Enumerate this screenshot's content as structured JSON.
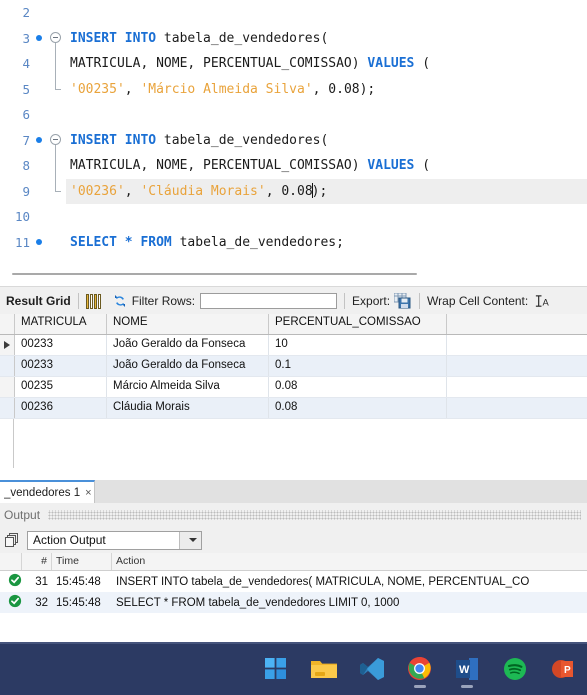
{
  "editor": {
    "lines": [
      {
        "num": "2",
        "bp": false,
        "fold": "none",
        "tokens": []
      },
      {
        "num": "3",
        "bp": true,
        "fold": "start",
        "tokens": [
          {
            "t": "kw",
            "v": "INSERT INTO "
          },
          {
            "t": "id",
            "v": "tabela_de_vendedores("
          }
        ]
      },
      {
        "num": "4",
        "bp": false,
        "fold": "mid",
        "tokens": [
          {
            "t": "id",
            "v": "MATRICULA, NOME, PERCENTUAL_COMISSAO) "
          },
          {
            "t": "kw",
            "v": "VALUES "
          },
          {
            "t": "id",
            "v": "("
          }
        ]
      },
      {
        "num": "5",
        "bp": false,
        "fold": "end",
        "tokens": [
          {
            "t": "str",
            "v": "'00235'"
          },
          {
            "t": "pun",
            "v": ", "
          },
          {
            "t": "str",
            "v": "'Márcio Almeida Silva'"
          },
          {
            "t": "pun",
            "v": ", "
          },
          {
            "t": "num",
            "v": "0.08"
          },
          {
            "t": "pun",
            "v": ");"
          }
        ]
      },
      {
        "num": "6",
        "bp": false,
        "fold": "none",
        "tokens": []
      },
      {
        "num": "7",
        "bp": true,
        "fold": "start",
        "tokens": [
          {
            "t": "kw",
            "v": "INSERT INTO "
          },
          {
            "t": "id",
            "v": "tabela_de_vendedores("
          }
        ]
      },
      {
        "num": "8",
        "bp": false,
        "fold": "mid",
        "tokens": [
          {
            "t": "id",
            "v": "MATRICULA, NOME, PERCENTUAL_COMISSAO) "
          },
          {
            "t": "kw",
            "v": "VALUES "
          },
          {
            "t": "id",
            "v": "("
          }
        ]
      },
      {
        "num": "9",
        "bp": false,
        "fold": "end",
        "highlight": true,
        "tokens": [
          {
            "t": "str",
            "v": "'00236'"
          },
          {
            "t": "pun",
            "v": ", "
          },
          {
            "t": "str",
            "v": "'Cláudia Morais'"
          },
          {
            "t": "pun",
            "v": ", "
          },
          {
            "t": "num",
            "v": "0.08"
          },
          {
            "t": "caret",
            "v": ""
          },
          {
            "t": "pun",
            "v": ");"
          }
        ]
      },
      {
        "num": "10",
        "bp": false,
        "fold": "none",
        "tokens": []
      },
      {
        "num": "11",
        "bp": true,
        "fold": "none",
        "tokens": [
          {
            "t": "kw",
            "v": "SELECT "
          },
          {
            "t": "kw",
            "v": "* "
          },
          {
            "t": "kw",
            "v": "FROM "
          },
          {
            "t": "id",
            "v": "tabela_de_vendedores;"
          }
        ]
      }
    ]
  },
  "result_toolbar": {
    "title": "Result Grid",
    "grid_icon": "grid-view-icon",
    "refresh_icon": "refresh-icon",
    "filter_label": "Filter Rows:",
    "filter_value": "",
    "filter_placeholder": "",
    "export_label": "Export:",
    "export_icon": "export-save-icon",
    "wrap_label": "Wrap Cell Content:",
    "wrap_icon": "wrap-text-icon"
  },
  "result_grid": {
    "columns": [
      "MATRICULA",
      "NOME",
      "PERCENTUAL_COMISSAO"
    ],
    "rows": [
      {
        "selected": true,
        "cells": [
          "00233",
          "João Geraldo da Fonseca",
          "10"
        ]
      },
      {
        "selected": false,
        "cells": [
          "00233",
          "João Geraldo da Fonseca",
          "0.1"
        ]
      },
      {
        "selected": false,
        "cells": [
          "00235",
          "Márcio Almeida Silva",
          "0.08"
        ]
      },
      {
        "selected": false,
        "cells": [
          "00236",
          "Cláudia Morais",
          "0.08"
        ]
      }
    ],
    "row_marker": "▶"
  },
  "bottom": {
    "tab_label": "_vendedores 1",
    "tab_close": "×",
    "output_label": "Output",
    "stack_icon": "panels-icon",
    "combo_value": "Action Output",
    "combo_caret": "chevron-down-icon"
  },
  "log": {
    "columns": [
      "",
      "#",
      "Time",
      "Action"
    ],
    "rows": [
      {
        "status": "success",
        "num": "31",
        "time": "15:45:48",
        "action": "INSERT INTO tabela_de_vendedores( MATRICULA, NOME, PERCENTUAL_CO"
      },
      {
        "status": "success",
        "num": "32",
        "time": "15:45:48",
        "action": "SELECT * FROM tabela_de_vendedores LIMIT 0, 1000"
      }
    ]
  },
  "taskbar": {
    "background": "#2c3a63",
    "items": [
      {
        "name": "start-button-icon",
        "label": "Start",
        "running": false
      },
      {
        "name": "file-explorer-icon",
        "label": "File Explorer",
        "running": false
      },
      {
        "name": "vscode-icon",
        "label": "Visual Studio Code",
        "running": false
      },
      {
        "name": "chrome-icon",
        "label": "Google Chrome",
        "running": true
      },
      {
        "name": "word-icon",
        "label": "Microsoft Word",
        "running": true
      },
      {
        "name": "spotify-icon",
        "label": "Spotify",
        "running": false
      },
      {
        "name": "powerpoint-icon",
        "label": "Microsoft PowerPoint",
        "running": false
      }
    ]
  },
  "colors": {
    "keyword": "#1a6fd4",
    "string": "#e9a33b",
    "identifier": "#1b1b1b",
    "gutter": "#5a87c4",
    "breakpoint": "#1a7ee8",
    "tab_accent": "#4a90d9",
    "grid_alt_row": "#eaf0f8",
    "success": "#1a9641"
  }
}
